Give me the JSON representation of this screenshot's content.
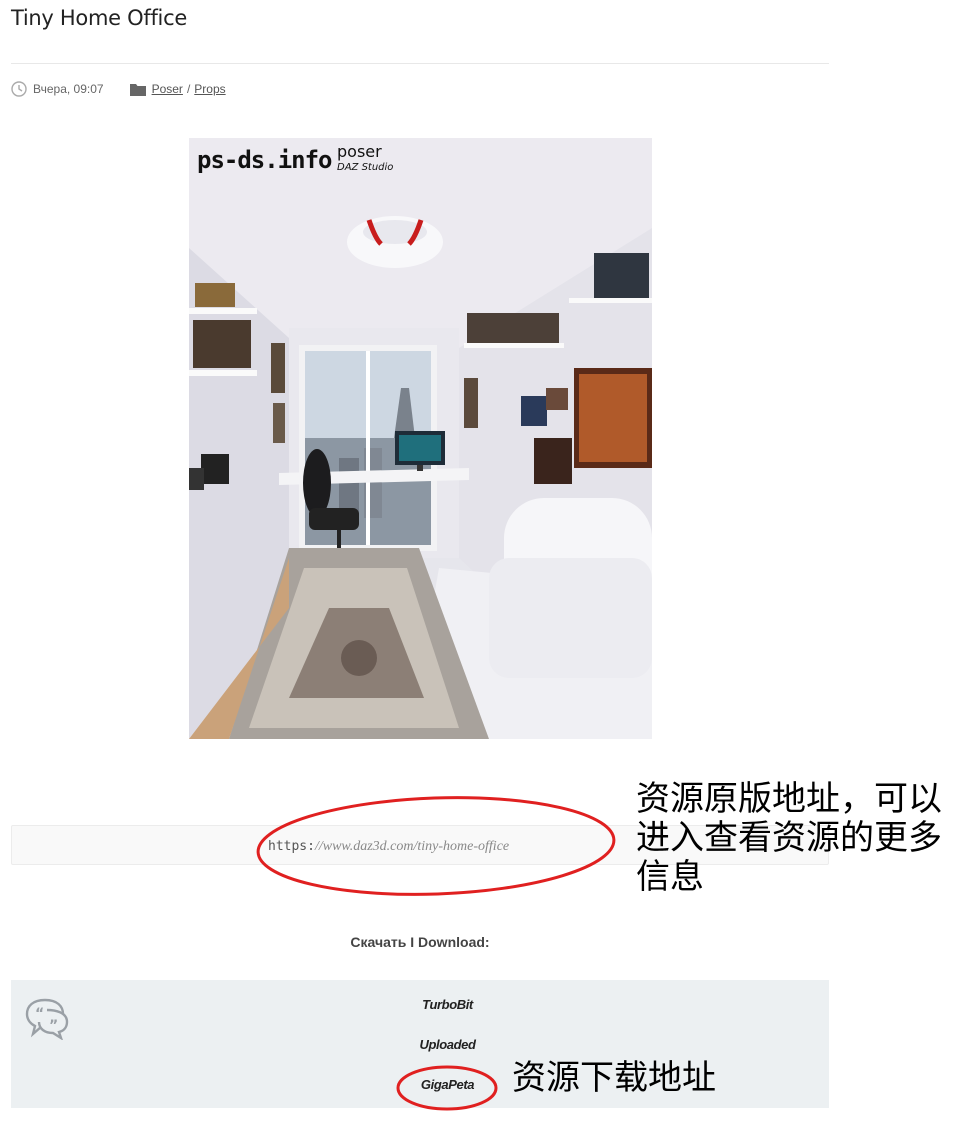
{
  "post": {
    "title": "Tiny Home Office",
    "date": "Вчера, 09:07",
    "category_parent": "Poser",
    "category_separator": "/",
    "category_child": "Props"
  },
  "image": {
    "watermark_site": "ps-ds.info",
    "watermark_poser": "poser",
    "watermark_daz": "DAZ Studio"
  },
  "source": {
    "url_prefix": "https:",
    "url_rest": "//www.daz3d.com/tiny-home-office"
  },
  "annotations": {
    "source_note": "资源原版地址，可以进入查看资源的更多信息",
    "download_note": "资源下载地址"
  },
  "download": {
    "heading": "Скачать I Download:",
    "links": [
      "TurboBit",
      "Uploaded",
      "GigaPeta"
    ]
  },
  "icons": {
    "date": "clock-icon",
    "category": "folder-icon",
    "quote": "speech-bubble-quote-icon"
  },
  "colors": {
    "annotation_red": "#e02020",
    "download_bg": "#ecf0f2"
  }
}
